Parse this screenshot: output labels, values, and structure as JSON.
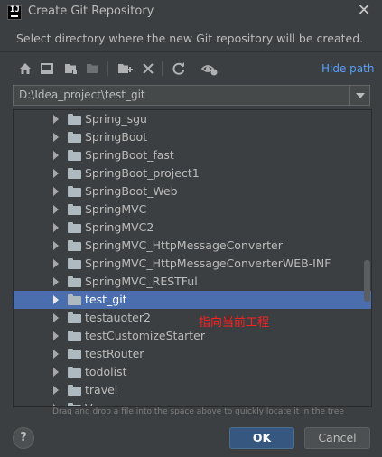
{
  "window": {
    "app_icon_text": "IJ",
    "title": "Create Git Repository",
    "close_glyph": "✕"
  },
  "description": "Select directory where the new Git repository will be created.",
  "toolbar": {
    "icons": [
      "home-icon",
      "desktop-icon",
      "project-folder-icon",
      "module-folder-icon",
      "new-folder-icon",
      "delete-icon",
      "refresh-icon",
      "show-hidden-icon"
    ],
    "hide_path_label": "Hide path"
  },
  "path_field": {
    "value": "D:\\Idea_project\\test_git"
  },
  "tree": {
    "items": [
      {
        "label": "Spring_sgu"
      },
      {
        "label": "SpringBoot"
      },
      {
        "label": "SpringBoot_fast"
      },
      {
        "label": "SpringBoot_project1"
      },
      {
        "label": "SpringBoot_Web"
      },
      {
        "label": "SpringMVC"
      },
      {
        "label": "SpringMVC2"
      },
      {
        "label": "SpringMVC_HttpMessageConverter"
      },
      {
        "label": "SpringMVC_HttpMessageConverterWEB-INF"
      },
      {
        "label": "SpringMVC_RESTFul"
      },
      {
        "label": "test_git",
        "selected": true
      },
      {
        "label": "testauoter2"
      },
      {
        "label": "testCustomizeStarter"
      },
      {
        "label": "testRouter"
      },
      {
        "label": "todolist"
      },
      {
        "label": "travel"
      },
      {
        "label": "V..."
      }
    ]
  },
  "annotation": "指向当前工程",
  "hint": "Drag and drop a file into the space above to quickly locate it in the tree",
  "buttons": {
    "help": "?",
    "ok": "OK",
    "cancel": "Cancel"
  },
  "colors": {
    "background": "#3c3f41",
    "selection": "#4b6eaf",
    "link": "#589df6",
    "ok_button": "#365880",
    "annotation": "#ff2020"
  }
}
